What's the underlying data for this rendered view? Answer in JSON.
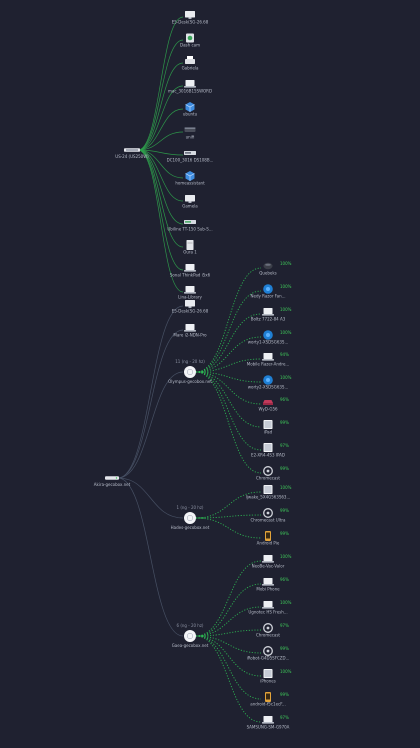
{
  "colors": {
    "background": "#1f2130",
    "wired_link": "#2fa24d",
    "wired_link_dim": "#4a5468",
    "wireless_link": "#2fbf55",
    "signal_good": "#3fca5a",
    "label": "#b7bcc9"
  },
  "switch_top": {
    "name": "US-24 (US250W)",
    "clients": [
      {
        "name": "E5-Desk(SG-26.68",
        "icon": "desktop-icon"
      },
      {
        "name": "Dash cam",
        "icon": "camera-icon"
      },
      {
        "name": "Gabriela",
        "icon": "printer-icon"
      },
      {
        "name": "mac_3016B15SWORD",
        "icon": "laptop-icon"
      },
      {
        "name": "ubuntu",
        "icon": "vm-cube-icon"
      },
      {
        "name": "unifi",
        "icon": "router-icon"
      },
      {
        "name": "DC100_3016 DS108B...",
        "icon": "nas-icon"
      },
      {
        "name": "homeassistant",
        "icon": "vm-cube-icon"
      },
      {
        "name": "Gamela",
        "icon": "monitor-icon"
      },
      {
        "name": "Ubiline TT-150 Sub-S...",
        "icon": "switch-icon"
      },
      {
        "name": "Oura 1",
        "icon": "server-icon"
      },
      {
        "name": "Sonal ThinkPad i5x6",
        "icon": "laptop-icon"
      },
      {
        "name": "Lina-Library",
        "icon": "laptop-icon"
      }
    ]
  },
  "gateway": {
    "name": "Akira-gecobox.net",
    "direct_clients": [
      {
        "name": "E5-Desk(SG-26.68",
        "icon": "desktop-icon"
      },
      {
        "name": "Mare i2-NDN-Pro",
        "icon": "laptop-icon"
      }
    ]
  },
  "access_points": [
    {
      "name": "Olympus-gecobox.net",
      "channel": "11 (ng - 20 hz)",
      "clients": [
        {
          "name": "Quebeks",
          "icon": "speaker-icon",
          "signal": "100%"
        },
        {
          "name": "Nedy Razor Fan...",
          "icon": "robot-icon",
          "signal": "100%"
        },
        {
          "name": "Boltz 7722-84 A3",
          "icon": "laptop-icon",
          "signal": "100%"
        },
        {
          "name": "worty1-XSDSG63S...",
          "icon": "robot-icon",
          "signal": "100%"
        },
        {
          "name": "Mobile Razer-Andre...",
          "icon": "laptop-icon",
          "signal": "94%"
        },
        {
          "name": "worty2-XSDSG63S...",
          "icon": "robot-icon",
          "signal": "100%"
        },
        {
          "name": "WyD-G56",
          "icon": "car-icon",
          "signal": "96%"
        },
        {
          "name": "iPad",
          "icon": "tablet-icon",
          "signal": "99%"
        },
        {
          "name": "E2-XR4-4S3 IPAD",
          "icon": "tablet-icon",
          "signal": "97%"
        },
        {
          "name": "Chromecast",
          "icon": "chromecast-icon",
          "signal": "99%"
        }
      ]
    },
    {
      "name": "Hades-gecobox.net",
      "channel": "1 (ng - 20 hz)",
      "clients": [
        {
          "name": "ljwake_5X4G563S63...",
          "icon": "tablet-icon",
          "signal": "100%"
        },
        {
          "name": "Chromecast Ultra",
          "icon": "chromecast-icon",
          "signal": "99%"
        },
        {
          "name": "Android Pie",
          "icon": "phone-icon",
          "signal": "99%"
        }
      ]
    },
    {
      "name": "Gaea-gecobox.net",
      "channel": "6 (ng - 20 hz)",
      "clients": [
        {
          "name": "NeoBe-Vac-Valor",
          "icon": "laptop-icon",
          "signal": "100%"
        },
        {
          "name": "Mobi Phone",
          "icon": "laptop-icon",
          "signal": "96%"
        },
        {
          "name": "Ugnotec HS Fresh...",
          "icon": "laptop-icon",
          "signal": "100%"
        },
        {
          "name": "Chromecast",
          "icon": "chromecast-icon",
          "signal": "97%"
        },
        {
          "name": "iRobot-G4D5SFCZD...",
          "icon": "chromecast-icon",
          "signal": "99%"
        },
        {
          "name": "iPhones",
          "icon": "tablet-icon",
          "signal": "100%"
        },
        {
          "name": "android-f5c1ecF...",
          "icon": "phone-icon",
          "signal": "99%"
        },
        {
          "name": "SAMSUNG-SM-G970A",
          "icon": "laptop-icon",
          "signal": "97%"
        }
      ]
    }
  ]
}
